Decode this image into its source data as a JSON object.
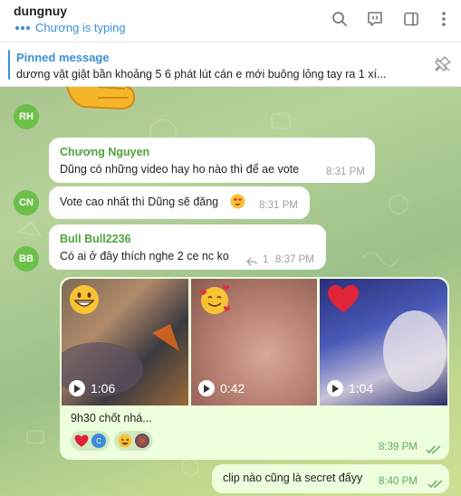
{
  "header": {
    "title": "dungnuy",
    "typing": "Chương is typing"
  },
  "pinned": {
    "label": "Pinned message",
    "text": "dương vật giật bần khoảng 5 6 phát lút cán e mới buông lỏng tay ra 1 xí..."
  },
  "messages": [
    {
      "avatar": "RH"
    },
    {
      "sender": "Chương Nguyen",
      "text": "Dũng có những video hay ho nào thì để ae vote",
      "time": "8:31 PM"
    },
    {
      "avatar": "CN",
      "text": "Vote cao nhất thì Dũng sẽ đăng",
      "time": "8:31 PM"
    },
    {
      "avatar": "BB",
      "sender": "Bull Bull2236",
      "text": "Có ai ở đây thích nghe 2 ce nc ko",
      "replies": "1",
      "time": "8:37 PM"
    },
    {
      "videos": [
        {
          "duration": "1:06",
          "emoji": "grinning-face"
        },
        {
          "duration": "0:42",
          "emoji": "smiling-face-with-hearts"
        },
        {
          "duration": "1:04",
          "emoji": "red-heart"
        }
      ],
      "text": "9h30 chốt nhá...",
      "time": "8:39 PM",
      "reactions": [
        {
          "emoji": "red-heart",
          "user": "C"
        },
        {
          "emoji": "laughing-face",
          "user": "avatar"
        }
      ]
    },
    {
      "text": "clip nào cũng là secret đấyy",
      "time": "8:40 PM"
    }
  ],
  "colors": {
    "accent": "#3a8fd8",
    "sender_name": "#4ea23c",
    "avatar_bg": "#6cc04a",
    "outgoing_bubble": "#eeffde"
  }
}
